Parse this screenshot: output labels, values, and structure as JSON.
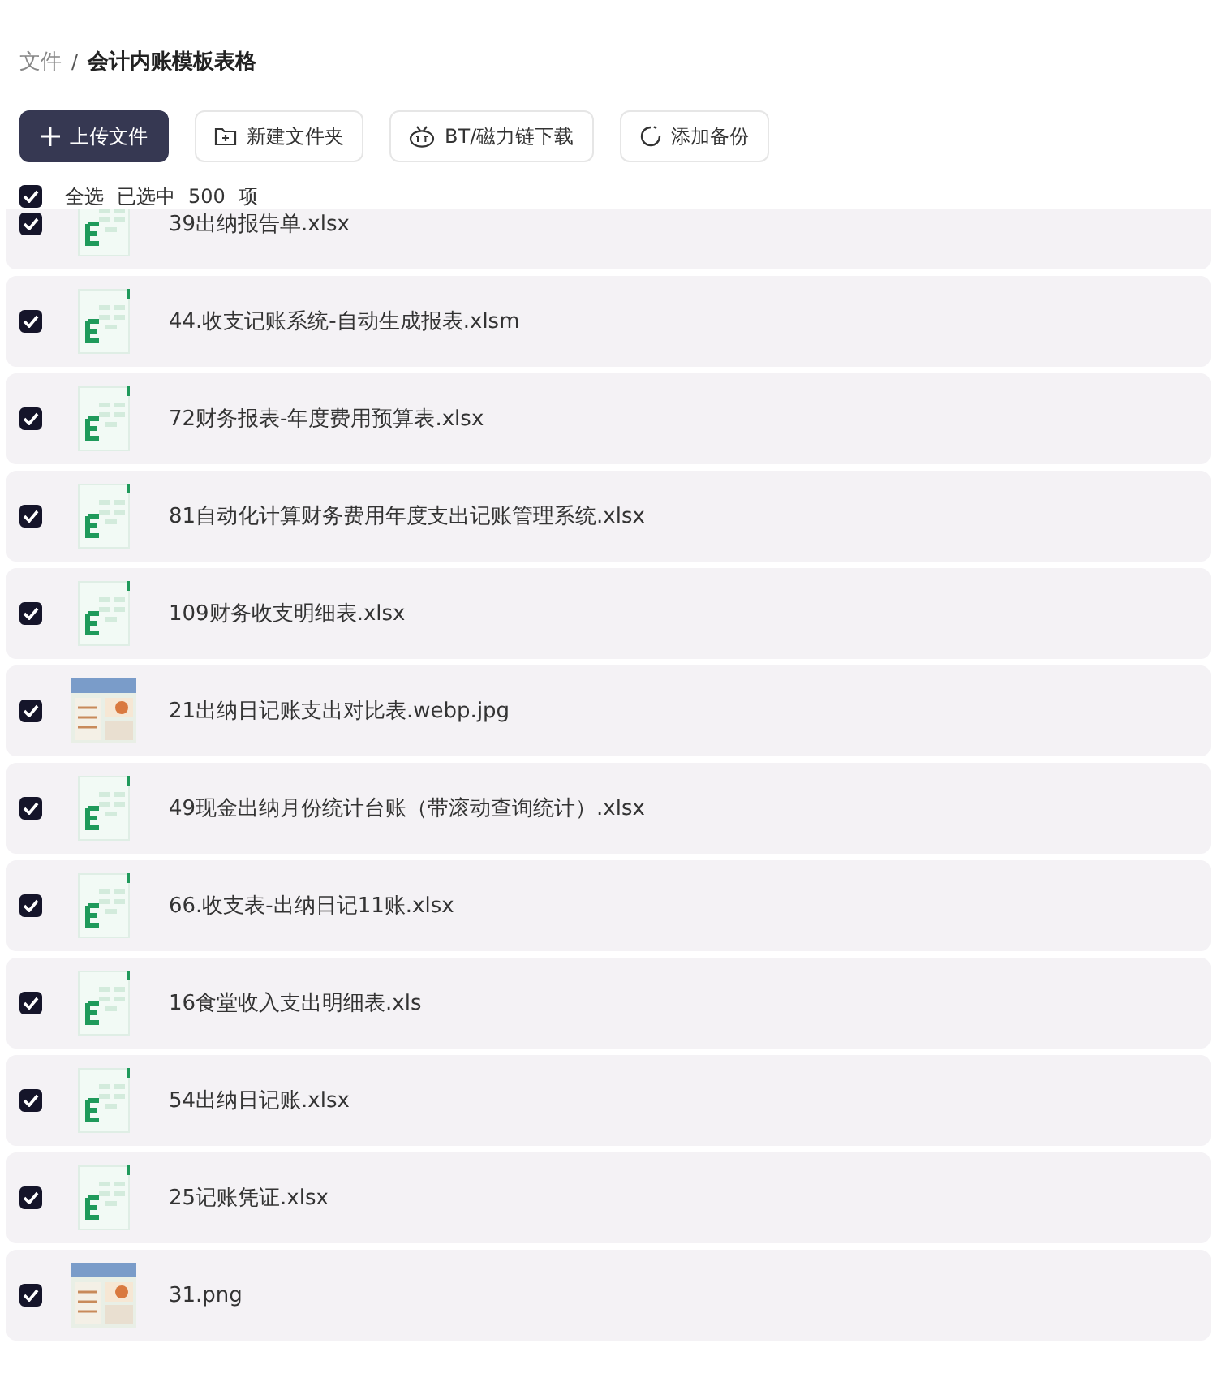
{
  "breadcrumb": {
    "root": "文件",
    "separator": "/",
    "current": "会计内账模板表格"
  },
  "toolbar": [
    {
      "kind": "upload",
      "label": "上传文件"
    },
    {
      "kind": "folder",
      "label": "新建文件夹"
    },
    {
      "kind": "bt",
      "label": "BT/磁力链下载"
    },
    {
      "kind": "backup",
      "label": "添加备份"
    }
  ],
  "selection": {
    "checked": true,
    "label": "全选",
    "summary": "已选中",
    "count": "500",
    "unit": "项"
  },
  "files": [
    {
      "name": "39出纳报告单.xlsx",
      "kind": "sheet",
      "checked": true
    },
    {
      "name": "44.收支记账系统-自动生成报表.xlsm",
      "kind": "sheet",
      "checked": true
    },
    {
      "name": "72财务报表-年度费用预算表.xlsx",
      "kind": "sheet",
      "checked": true
    },
    {
      "name": "81自动化计算财务费用年度支出记账管理系统.xlsx",
      "kind": "sheet",
      "checked": true
    },
    {
      "name": "109财务收支明细表.xlsx",
      "kind": "sheet",
      "checked": true
    },
    {
      "name": "21出纳日记账支出对比表.webp.jpg",
      "kind": "picture",
      "checked": true
    },
    {
      "name": "49现金出纳月份统计台账（带滚动查询统计）.xlsx",
      "kind": "sheet",
      "checked": true
    },
    {
      "name": "66.收支表-出纳日记11账.xlsx",
      "kind": "sheet",
      "checked": true
    },
    {
      "name": "16食堂收入支出明细表.xls",
      "kind": "sheet",
      "checked": true
    },
    {
      "name": "54出纳日记账.xlsx",
      "kind": "sheet",
      "checked": true
    },
    {
      "name": "25记账凭证.xlsx",
      "kind": "sheet",
      "checked": true
    },
    {
      "name": "31.png",
      "kind": "picture",
      "checked": true
    }
  ]
}
